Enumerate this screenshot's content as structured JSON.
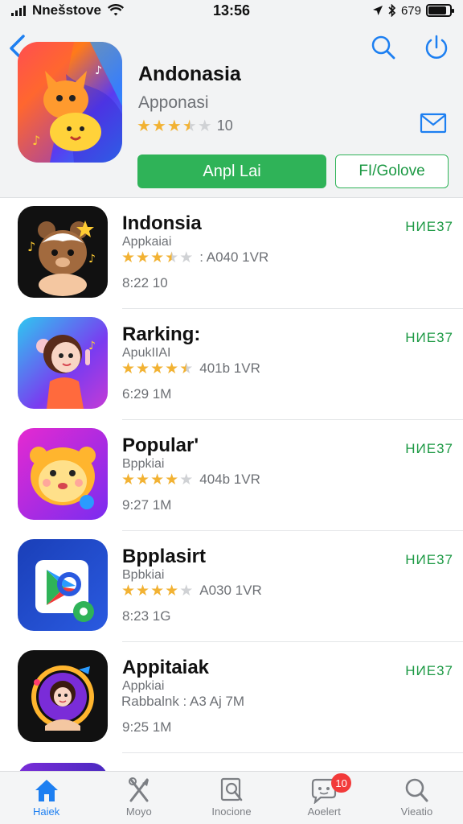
{
  "status_bar": {
    "carrier": "Nnešstove",
    "time": "13:56",
    "battery_text": "679"
  },
  "header": {
    "app_title": "Andonasia",
    "app_subtitle": "Apponasi",
    "rating_count": "10",
    "rating_stars": 3.5,
    "primary_button": "Anpl Lai",
    "secondary_button": "FI/Golove"
  },
  "list": {
    "items": [
      {
        "title": "Indonsia",
        "subtitle": "Appkaiai",
        "rating_stars": 3.5,
        "meta": ": A040  1VR",
        "size": "8:22 10",
        "action": "HИE37"
      },
      {
        "title": "Rarking:",
        "subtitle": "ApukIIAI",
        "rating_stars": 4.5,
        "meta": "401b  1VR",
        "size": "6:29 1M",
        "action": "HИE37"
      },
      {
        "title": "Popular'",
        "subtitle": "Bppkiai",
        "rating_stars": 4,
        "meta": "404b  1VR",
        "size": "9:27 1M",
        "action": "HИE37"
      },
      {
        "title": "Bpplasirt",
        "subtitle": "Bpbkiai",
        "rating_stars": 4,
        "meta": "A030  1VR",
        "size": "8:23 1G",
        "action": "HИE37"
      },
      {
        "title": "Appitaiak",
        "subtitle": "Appkiai",
        "rating_stars": 0,
        "meta": "Rabbalnk : A3 Aj  7M",
        "size": "9:25 1M",
        "action": "HИE37"
      }
    ]
  },
  "tab_bar": {
    "tabs": [
      {
        "label": "Haiek",
        "icon": "home-icon",
        "active": true
      },
      {
        "label": "Moyo",
        "icon": "apps-icon",
        "active": false
      },
      {
        "label": "Inocione",
        "icon": "search-doc-icon",
        "active": false
      },
      {
        "label": "Aoelert",
        "icon": "chat-icon",
        "active": false,
        "badge": "10"
      },
      {
        "label": "Vieatio",
        "icon": "search-icon",
        "active": false
      }
    ]
  },
  "colors": {
    "accent_blue": "#1d7ff1",
    "accent_green": "#2fb358",
    "star": "#f2b233",
    "badge_red": "#f23a3a"
  }
}
